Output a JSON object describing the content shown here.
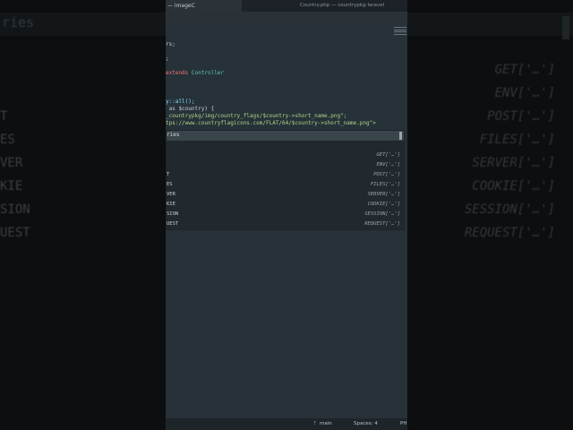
{
  "window": {
    "tab_label": "— imageC",
    "title": "Country.php — countrypkg-laravel"
  },
  "code_lines": [
    {
      "t": "rs;",
      "cls": "c-w"
    },
    {
      "t": ";",
      "cls": "c-w"
    },
    {
      "t": "extends",
      "cls": "c-r",
      "t2": " Controller",
      "cls2": "c-t"
    },
    {
      "t": "y::all();",
      "cls": "c-c"
    },
    {
      "t": " as $country) {",
      "cls": "c-w"
    },
    {
      "t": "_countrypkg/img/country_flags/$country->short_name.png\";",
      "cls": "c-g"
    },
    {
      "t": "tps://www.countryflagicons.com/FLAT/64/$country->short_name.png\">",
      "cls": "c-g"
    }
  ],
  "popup": {
    "header": "ries",
    "items": [
      {
        "left": "",
        "right": "GET['…']"
      },
      {
        "left": "",
        "right": "ENV['…']"
      },
      {
        "left": "T",
        "right": "POST['…']"
      },
      {
        "left": "ES",
        "right": "FILES['…']"
      },
      {
        "left": "VER",
        "right": "SERVER['…']"
      },
      {
        "left": "KIE",
        "right": "COOKIE['…']"
      },
      {
        "left": "SION",
        "right": "SESSION['…']"
      },
      {
        "left": "UEST",
        "right": "REQUEST['…']"
      }
    ]
  },
  "statusbar": {
    "branch": "main",
    "branch_icon": "git-branch-icon",
    "spaces": "Spaces: 4",
    "language": "PH"
  },
  "background": {
    "title": "ries",
    "left_items": [
      "T",
      "ES",
      "VER",
      "KIE",
      "SION",
      "UEST"
    ],
    "right_items": [
      "GET['…']",
      "ENV['…']",
      "POST['…']",
      "FILES['…']",
      "SERVER['…']",
      "COOKIE['…']",
      "SESSION['…']",
      "REQUEST['…']"
    ]
  }
}
